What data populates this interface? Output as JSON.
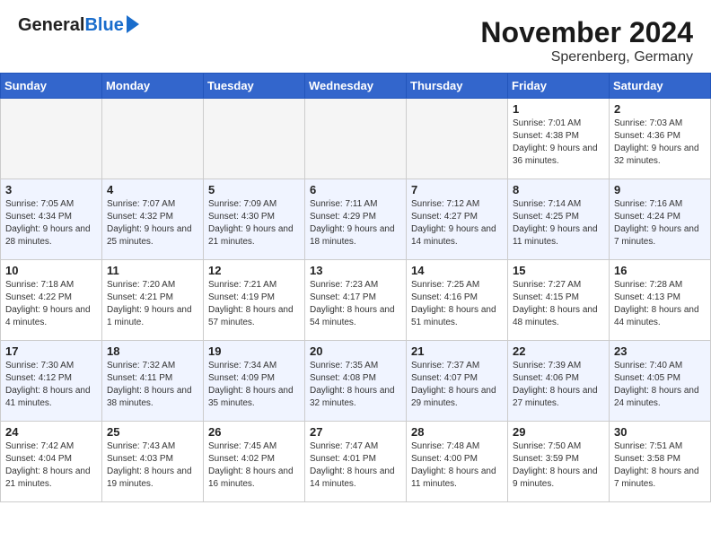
{
  "header": {
    "logo_general": "General",
    "logo_blue": "Blue",
    "month_title": "November 2024",
    "location": "Sperenberg, Germany"
  },
  "weekdays": [
    "Sunday",
    "Monday",
    "Tuesday",
    "Wednesday",
    "Thursday",
    "Friday",
    "Saturday"
  ],
  "weeks": [
    [
      {
        "day": "",
        "info": ""
      },
      {
        "day": "",
        "info": ""
      },
      {
        "day": "",
        "info": ""
      },
      {
        "day": "",
        "info": ""
      },
      {
        "day": "",
        "info": ""
      },
      {
        "day": "1",
        "info": "Sunrise: 7:01 AM\nSunset: 4:38 PM\nDaylight: 9 hours\nand 36 minutes."
      },
      {
        "day": "2",
        "info": "Sunrise: 7:03 AM\nSunset: 4:36 PM\nDaylight: 9 hours\nand 32 minutes."
      }
    ],
    [
      {
        "day": "3",
        "info": "Sunrise: 7:05 AM\nSunset: 4:34 PM\nDaylight: 9 hours\nand 28 minutes."
      },
      {
        "day": "4",
        "info": "Sunrise: 7:07 AM\nSunset: 4:32 PM\nDaylight: 9 hours\nand 25 minutes."
      },
      {
        "day": "5",
        "info": "Sunrise: 7:09 AM\nSunset: 4:30 PM\nDaylight: 9 hours\nand 21 minutes."
      },
      {
        "day": "6",
        "info": "Sunrise: 7:11 AM\nSunset: 4:29 PM\nDaylight: 9 hours\nand 18 minutes."
      },
      {
        "day": "7",
        "info": "Sunrise: 7:12 AM\nSunset: 4:27 PM\nDaylight: 9 hours\nand 14 minutes."
      },
      {
        "day": "8",
        "info": "Sunrise: 7:14 AM\nSunset: 4:25 PM\nDaylight: 9 hours\nand 11 minutes."
      },
      {
        "day": "9",
        "info": "Sunrise: 7:16 AM\nSunset: 4:24 PM\nDaylight: 9 hours\nand 7 minutes."
      }
    ],
    [
      {
        "day": "10",
        "info": "Sunrise: 7:18 AM\nSunset: 4:22 PM\nDaylight: 9 hours\nand 4 minutes."
      },
      {
        "day": "11",
        "info": "Sunrise: 7:20 AM\nSunset: 4:21 PM\nDaylight: 9 hours\nand 1 minute."
      },
      {
        "day": "12",
        "info": "Sunrise: 7:21 AM\nSunset: 4:19 PM\nDaylight: 8 hours\nand 57 minutes."
      },
      {
        "day": "13",
        "info": "Sunrise: 7:23 AM\nSunset: 4:17 PM\nDaylight: 8 hours\nand 54 minutes."
      },
      {
        "day": "14",
        "info": "Sunrise: 7:25 AM\nSunset: 4:16 PM\nDaylight: 8 hours\nand 51 minutes."
      },
      {
        "day": "15",
        "info": "Sunrise: 7:27 AM\nSunset: 4:15 PM\nDaylight: 8 hours\nand 48 minutes."
      },
      {
        "day": "16",
        "info": "Sunrise: 7:28 AM\nSunset: 4:13 PM\nDaylight: 8 hours\nand 44 minutes."
      }
    ],
    [
      {
        "day": "17",
        "info": "Sunrise: 7:30 AM\nSunset: 4:12 PM\nDaylight: 8 hours\nand 41 minutes."
      },
      {
        "day": "18",
        "info": "Sunrise: 7:32 AM\nSunset: 4:11 PM\nDaylight: 8 hours\nand 38 minutes."
      },
      {
        "day": "19",
        "info": "Sunrise: 7:34 AM\nSunset: 4:09 PM\nDaylight: 8 hours\nand 35 minutes."
      },
      {
        "day": "20",
        "info": "Sunrise: 7:35 AM\nSunset: 4:08 PM\nDaylight: 8 hours\nand 32 minutes."
      },
      {
        "day": "21",
        "info": "Sunrise: 7:37 AM\nSunset: 4:07 PM\nDaylight: 8 hours\nand 29 minutes."
      },
      {
        "day": "22",
        "info": "Sunrise: 7:39 AM\nSunset: 4:06 PM\nDaylight: 8 hours\nand 27 minutes."
      },
      {
        "day": "23",
        "info": "Sunrise: 7:40 AM\nSunset: 4:05 PM\nDaylight: 8 hours\nand 24 minutes."
      }
    ],
    [
      {
        "day": "24",
        "info": "Sunrise: 7:42 AM\nSunset: 4:04 PM\nDaylight: 8 hours\nand 21 minutes."
      },
      {
        "day": "25",
        "info": "Sunrise: 7:43 AM\nSunset: 4:03 PM\nDaylight: 8 hours\nand 19 minutes."
      },
      {
        "day": "26",
        "info": "Sunrise: 7:45 AM\nSunset: 4:02 PM\nDaylight: 8 hours\nand 16 minutes."
      },
      {
        "day": "27",
        "info": "Sunrise: 7:47 AM\nSunset: 4:01 PM\nDaylight: 8 hours\nand 14 minutes."
      },
      {
        "day": "28",
        "info": "Sunrise: 7:48 AM\nSunset: 4:00 PM\nDaylight: 8 hours\nand 11 minutes."
      },
      {
        "day": "29",
        "info": "Sunrise: 7:50 AM\nSunset: 3:59 PM\nDaylight: 8 hours\nand 9 minutes."
      },
      {
        "day": "30",
        "info": "Sunrise: 7:51 AM\nSunset: 3:58 PM\nDaylight: 8 hours\nand 7 minutes."
      }
    ]
  ]
}
